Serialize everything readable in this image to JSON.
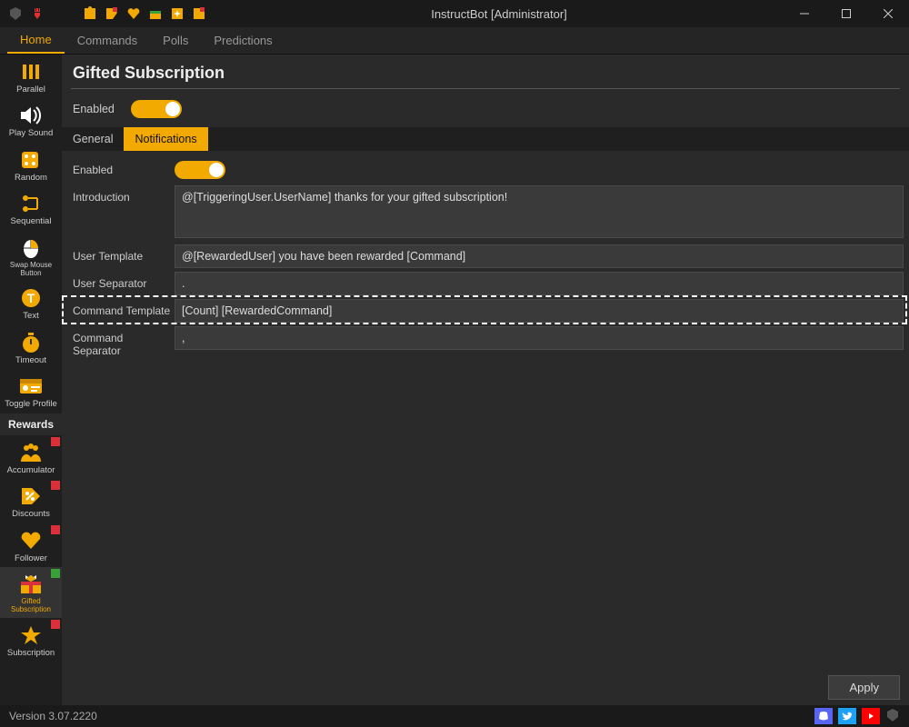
{
  "window": {
    "title": "InstructBot [Administrator]"
  },
  "menu": {
    "items": [
      "Home",
      "Commands",
      "Polls",
      "Predictions"
    ],
    "active_index": 0
  },
  "sidebar": {
    "items": [
      {
        "label": "Parallel",
        "icon": "parallel",
        "badge": null
      },
      {
        "label": "Play Sound",
        "icon": "sound",
        "badge": null
      },
      {
        "label": "Random",
        "icon": "dice",
        "badge": null
      },
      {
        "label": "Sequential",
        "icon": "sequential",
        "badge": null
      },
      {
        "label": "Swap Mouse Button",
        "icon": "mouse",
        "badge": null
      },
      {
        "label": "Text",
        "icon": "text",
        "badge": null
      },
      {
        "label": "Timeout",
        "icon": "stopwatch",
        "badge": null
      },
      {
        "label": "Toggle Profile",
        "icon": "profile",
        "badge": null
      }
    ],
    "section": "Rewards",
    "reward_items": [
      {
        "label": "Accumulator",
        "icon": "accumulator",
        "badge": "red"
      },
      {
        "label": "Discounts",
        "icon": "discount",
        "badge": "red"
      },
      {
        "label": "Follower",
        "icon": "heart",
        "badge": "red"
      },
      {
        "label": "Gifted Subscription",
        "icon": "gift",
        "badge": "green",
        "selected": true
      },
      {
        "label": "Subscription",
        "icon": "star",
        "badge": "red"
      }
    ]
  },
  "page": {
    "title": "Gifted Subscription",
    "enabled_label": "Enabled",
    "enabled": true,
    "tabs": [
      "General",
      "Notifications"
    ],
    "active_tab": 1,
    "notifications": {
      "enabled_label": "Enabled",
      "enabled": true,
      "fields": {
        "introduction": {
          "label": "Introduction",
          "value": "@[TriggeringUser.UserName] thanks for your gifted subscription!"
        },
        "user_template": {
          "label": "User Template",
          "value": "@[RewardedUser] you have been rewarded [Command]"
        },
        "user_separator": {
          "label": "User Separator",
          "value": "."
        },
        "command_template": {
          "label": "Command Template",
          "value": "[Count] [RewardedCommand]"
        },
        "command_separator": {
          "label": "Command Separator",
          "value": ","
        }
      }
    },
    "apply_label": "Apply"
  },
  "status": {
    "version": "Version 3.07.2220"
  }
}
